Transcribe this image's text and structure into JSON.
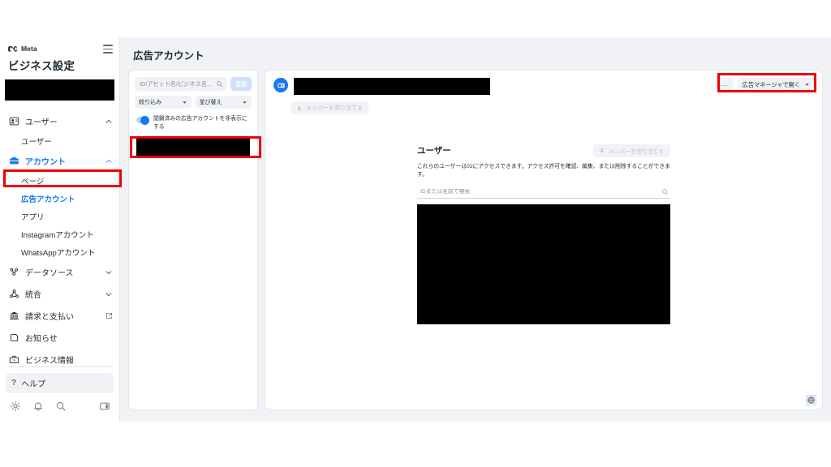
{
  "brand": {
    "name": "Meta",
    "title": "ビジネス設定",
    "accent": "#1877f2",
    "annotation_color": "#ee0000"
  },
  "sidebar": {
    "account_redacted": "",
    "groups": [
      {
        "icon": "users-icon",
        "label": "ユーザー",
        "expanded": true,
        "chevron": "chevron-up-icon",
        "items": [
          {
            "label": "ユーザー",
            "selected": false
          }
        ]
      },
      {
        "icon": "accounts-icon",
        "label": "アカウント",
        "expanded": true,
        "chevron": "chevron-up-icon",
        "items": [
          {
            "label": "ページ",
            "selected": false
          },
          {
            "label": "広告アカウント",
            "selected": true
          },
          {
            "label": "アプリ",
            "selected": false
          },
          {
            "label": "Instagramアカウント",
            "selected": false
          },
          {
            "label": "WhatsAppアカウント",
            "selected": false
          }
        ]
      },
      {
        "icon": "data-sources-icon",
        "label": "データソース",
        "expanded": false,
        "chevron": "chevron-down-icon",
        "items": []
      },
      {
        "icon": "integrations-icon",
        "label": "統合",
        "expanded": false,
        "chevron": "chevron-down-icon",
        "items": []
      },
      {
        "icon": "billing-icon",
        "label": "請求と支払い",
        "external": "external-link-icon",
        "items": []
      },
      {
        "icon": "notifications-icon",
        "label": "お知らせ",
        "items": []
      },
      {
        "icon": "business-info-icon",
        "label": "ビジネス情報",
        "items": []
      }
    ],
    "footer": {
      "help_label": "ヘルプ",
      "help_icon": "question-mark-icon",
      "tools": [
        "gear-icon",
        "bell-icon",
        "search-icon"
      ],
      "panel_toggle_icon": "panel-toggle-icon"
    }
  },
  "main": {
    "page_title": "広告アカウント",
    "list_panel": {
      "search_placeholder": "ID/アセット名/ビジネス名...",
      "search_value": "",
      "search_icon": "search-icon",
      "add_button": "追加",
      "filter_dropdown": "絞り込み",
      "sort_dropdown": "並び替え",
      "dropdown_icon": "chevron-down-icon",
      "toggle_label": "閉鎖済みの広告アカウントを非表示にする",
      "toggle_on": true,
      "selected_item_redacted": ""
    },
    "detail_panel": {
      "avatar_icon": "ad-account-icon",
      "account_name_redacted": "",
      "assign_member_top": "メンバーを割り当てる",
      "assign_member_top_icon": "person-add-icon",
      "more_button": "···",
      "open_button": "広告マネージャで開く",
      "open_button_icon": "chevron-down-icon",
      "users_section": {
        "title": "ユーザー",
        "assign_button": "メンバーを割り当てる",
        "assign_button_icon": "person-add-icon",
        "description": "これらのユーザーは02にアクセスできます。アクセス許可を確認、編集、または削除することができます。",
        "search_placeholder": "IDまたは名前で検索",
        "search_value": "",
        "search_icon": "search-icon",
        "table_redacted": ""
      }
    },
    "status_bar": {
      "globe_icon": "globe-icon"
    }
  },
  "annotations": [
    {
      "name": "ad-accounts-nav-highlight"
    },
    {
      "name": "selected-account-highlight"
    },
    {
      "name": "open-in-ads-manager-highlight"
    }
  ]
}
